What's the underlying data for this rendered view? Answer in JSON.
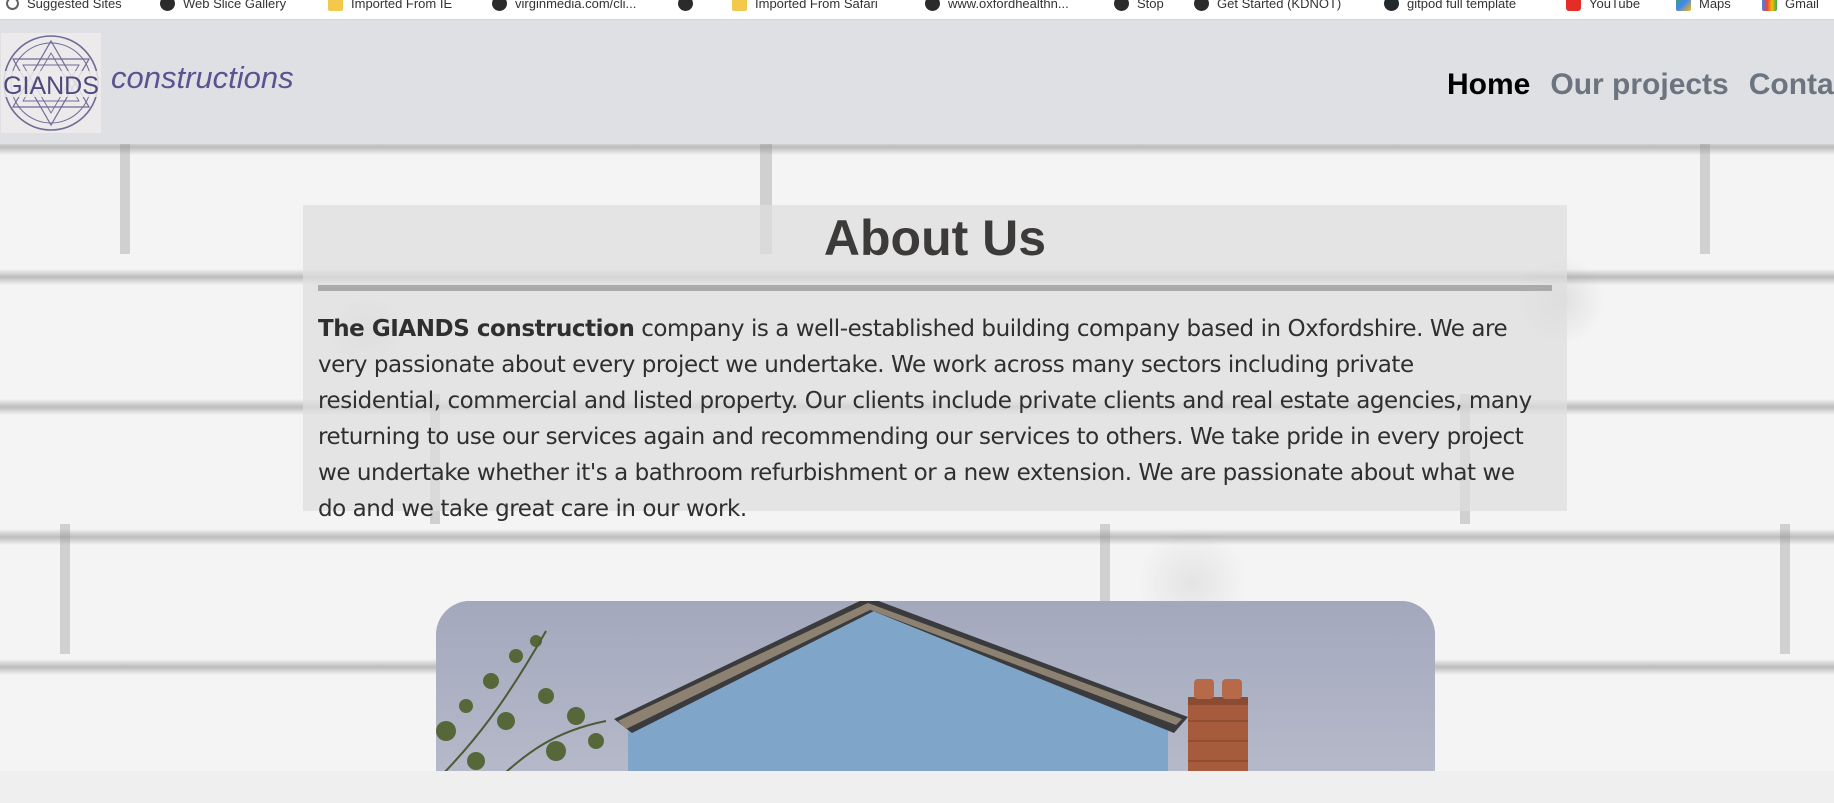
{
  "bookmarks": [
    {
      "label": "Suggested Sites",
      "icon": "search-icon"
    },
    {
      "label": "Web Slice Gallery",
      "icon": "globe-icon"
    },
    {
      "label": "Imported From IE",
      "icon": "folder-icon"
    },
    {
      "label": "virginmedia.com/cli...",
      "icon": "globe-icon"
    },
    {
      "label": "",
      "icon": "globe-icon"
    },
    {
      "label": "Imported From Safari",
      "icon": "folder-icon"
    },
    {
      "label": "www.oxfordhealthn...",
      "icon": "globe-icon"
    },
    {
      "label": "Stop",
      "icon": "globe-icon"
    },
    {
      "label": "Get Started (KDNOT)",
      "icon": "globe-icon"
    },
    {
      "label": "gitpod full template",
      "icon": "github-icon"
    },
    {
      "label": "YouTube",
      "icon": "youtube-icon"
    },
    {
      "label": "Maps",
      "icon": "maps-icon"
    },
    {
      "label": "Gmail",
      "icon": "gmail-icon"
    }
  ],
  "header": {
    "logo_text": "GIANDS",
    "brand": "constructions",
    "nav": [
      {
        "label": "Home",
        "active": true
      },
      {
        "label": "Our projects",
        "active": false
      },
      {
        "label": "Contact",
        "active": false
      }
    ]
  },
  "about": {
    "title": "About Us",
    "lead_bold": "The GIANDS construction",
    "body": " company is a well-established building company based in Oxfordshire. We are very passionate about every project we undertake. We work across many sectors including private residential, commercial and listed property. Our clients include private clients and real estate agencies, many returning to use our services again and recommending our services to others. We take pride in every project we undertake whether it's a bathroom refurbishment or a new extension. We are passionate about what we do and we take great care in our work."
  },
  "colors": {
    "header_bg": "#dee0e4",
    "brand": "#5a5391",
    "nav_inactive": "#6c7480",
    "nav_active": "#000000",
    "title": "#3d3a3a"
  }
}
